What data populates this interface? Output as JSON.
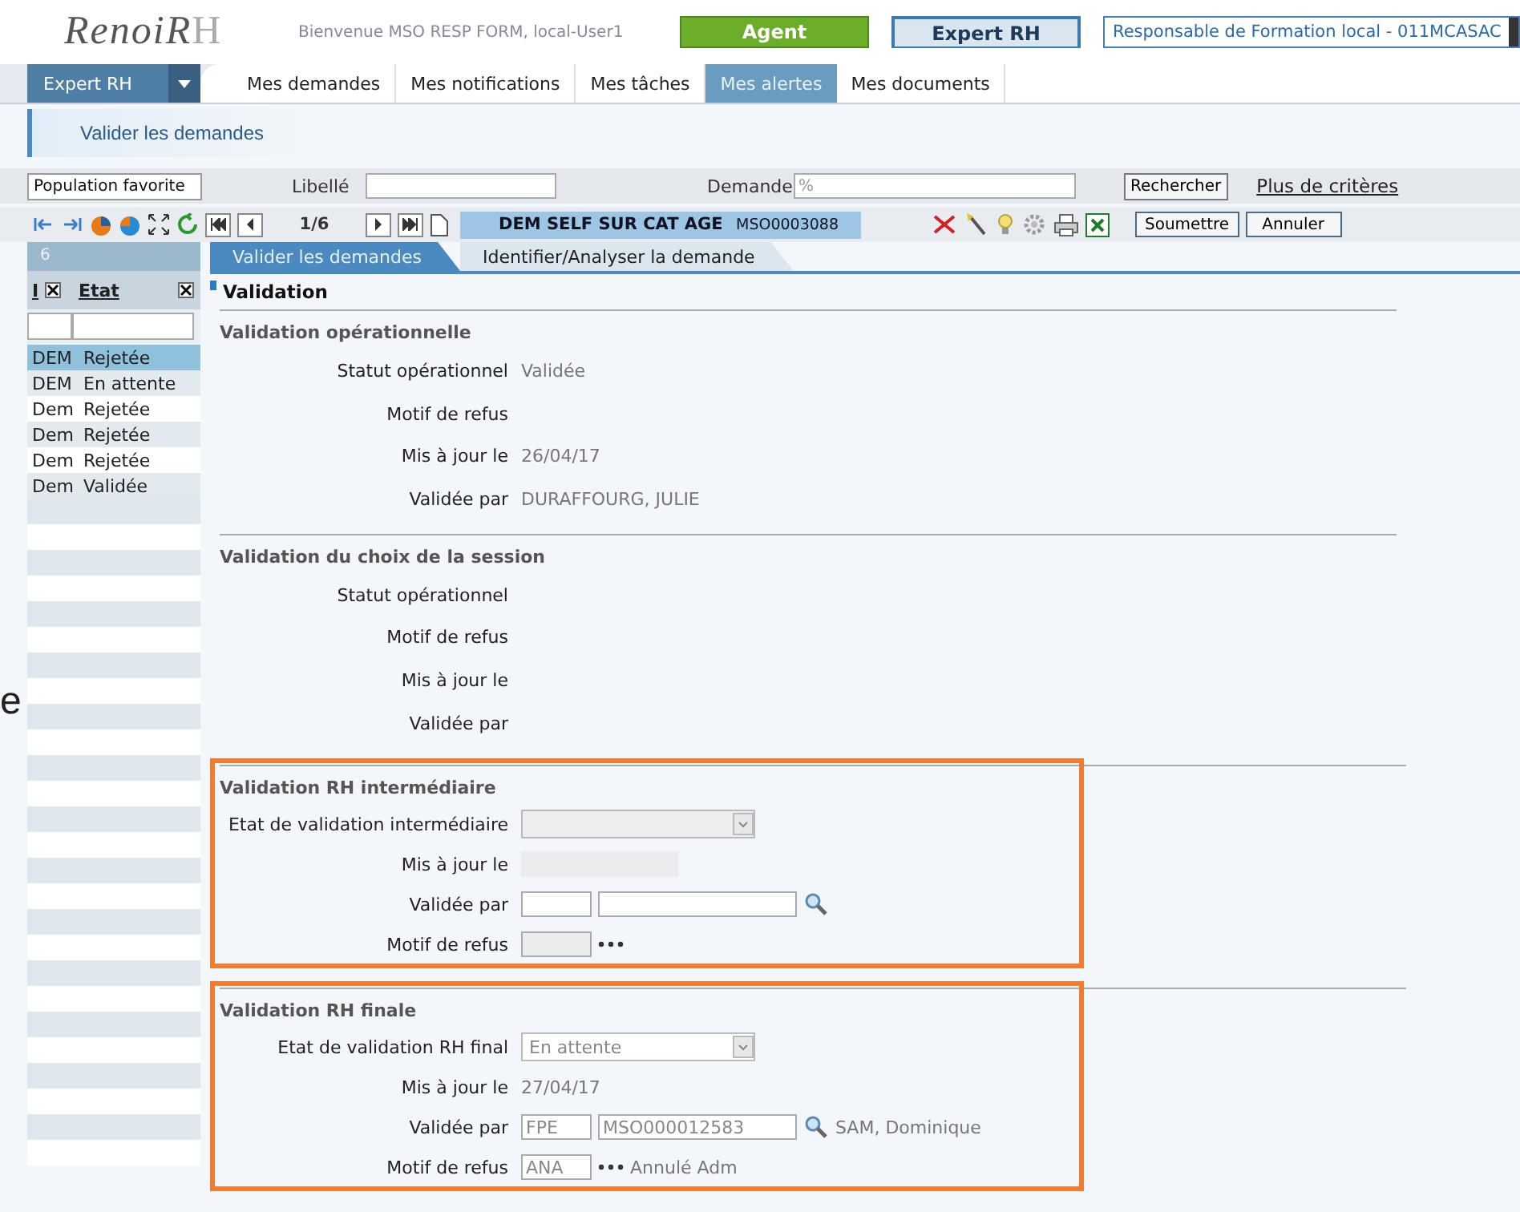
{
  "edge_fragment": "e",
  "header": {
    "logo": {
      "main": "RenoiR",
      "accent": "H"
    },
    "welcome": "Bienvenue MSO RESP FORM, local-User1",
    "roles": [
      {
        "label": "Agent",
        "kind": "green"
      },
      {
        "label": "Expert RH",
        "kind": "outlined"
      }
    ],
    "profile": "Responsable de Formation local - 011MCASAC"
  },
  "nav": {
    "menu": "Expert RH",
    "items": [
      {
        "label": "Mes demandes",
        "selected": false
      },
      {
        "label": "Mes notifications",
        "selected": false
      },
      {
        "label": "Mes tâches",
        "selected": false
      },
      {
        "label": "Mes alertes",
        "selected": true
      },
      {
        "label": "Mes documents",
        "selected": false
      }
    ]
  },
  "breadcrumb": "Valider les demandes",
  "search": {
    "population": "Population favorite",
    "libelle_label": "Libellé",
    "demande_label": "Demande",
    "demande_value": "%",
    "button": "Rechercher",
    "more_link": "Plus de critères"
  },
  "toolbar": {
    "pager": "1/6",
    "title": "DEM SELF SUR CAT AGE",
    "code": "MSO0003088",
    "buttons": [
      "Soumettre",
      "Annuler"
    ]
  },
  "list": {
    "count": "6",
    "columns": [
      "I",
      "Etat"
    ],
    "rows": [
      {
        "type": "DEM",
        "etat": "Rejetée",
        "selected": true
      },
      {
        "type": "DEM",
        "etat": "En attente",
        "selected": false
      },
      {
        "type": "Dem",
        "etat": "Rejetée",
        "selected": false
      },
      {
        "type": "Dem",
        "etat": "Rejetée",
        "selected": false
      },
      {
        "type": "Dem",
        "etat": "Rejetée",
        "selected": false
      },
      {
        "type": "Dem",
        "etat": "Validée",
        "selected": false
      }
    ]
  },
  "tabs": [
    {
      "label": "Valider les demandes",
      "selected": true
    },
    {
      "label": "Identifier/Analyser la demande",
      "selected": false
    }
  ],
  "title": "Validation",
  "sections": [
    {
      "title": "Validation opérationnelle",
      "highlighted": false,
      "fields": [
        {
          "kind": "text",
          "label": "Statut opérationnel",
          "value": "Validée"
        },
        {
          "kind": "text",
          "label": "Motif de refus"
        },
        {
          "kind": "text",
          "label": "Mis à jour le",
          "value": "26/04/17"
        },
        {
          "kind": "text",
          "label": "Validée par",
          "value": "DURAFFOURG, JULIE"
        }
      ]
    },
    {
      "title": "Validation du choix de la session",
      "highlighted": false,
      "fields": [
        {
          "kind": "text",
          "label": "Statut opérationnel"
        },
        {
          "kind": "text",
          "label": "Motif de refus"
        },
        {
          "kind": "text",
          "label": "Mis à jour le"
        },
        {
          "kind": "text",
          "label": "Validée par"
        }
      ]
    },
    {
      "title": "Validation RH intermédiaire",
      "highlighted": true,
      "fields": [
        {
          "kind": "select",
          "label": "Etat de validation intermédiaire",
          "disabled": true
        },
        {
          "kind": "box",
          "label": "Mis à jour le"
        },
        {
          "kind": "lookup",
          "label": "Validée par"
        },
        {
          "kind": "code",
          "label": "Motif de refus",
          "disabled": true
        }
      ]
    },
    {
      "title": "Validation RH finale",
      "highlighted": true,
      "fields": [
        {
          "kind": "select",
          "label": "Etat de validation RH final",
          "value": "En attente",
          "disabled": false
        },
        {
          "kind": "text",
          "label": "Mis à jour le",
          "value": "27/04/17"
        },
        {
          "kind": "lookup",
          "label": "Validée par",
          "code": "FPE",
          "id": "MSO000012583",
          "name": "SAM, Dominique"
        },
        {
          "kind": "code",
          "label": "Motif de refus",
          "value": "ANA",
          "description": "Annulé Adm",
          "disabled": false
        }
      ]
    }
  ]
}
